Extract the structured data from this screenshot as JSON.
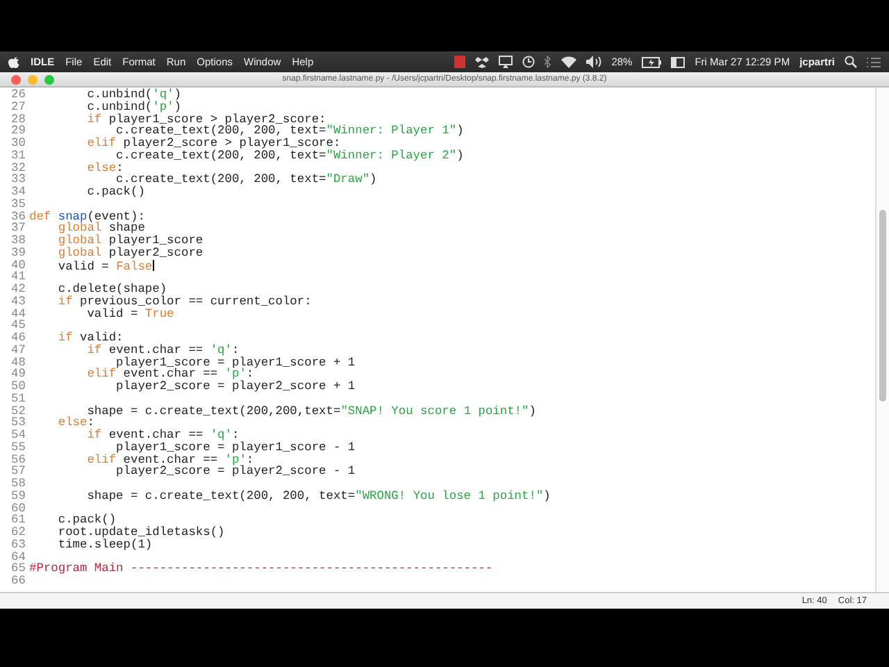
{
  "menu_bar": {
    "app_name": "IDLE",
    "menus": [
      "File",
      "Edit",
      "Format",
      "Run",
      "Options",
      "Window",
      "Help"
    ],
    "battery": "28%",
    "clock": "Fri Mar 27  12:29 PM",
    "user": "jcpartri"
  },
  "window": {
    "title": "snap.firstname.lastname.py - /Users/jcpartri/Desktop/snap.firstname.lastname.py (3.8.2)"
  },
  "editor": {
    "lines": [
      {
        "number": "26",
        "segments": [
          {
            "kind": "plain",
            "text": "        c.unbind("
          },
          {
            "kind": "string",
            "text": "'q'"
          },
          {
            "kind": "plain",
            "text": ")"
          }
        ]
      },
      {
        "number": "27",
        "segments": [
          {
            "kind": "plain",
            "text": "        c.unbind("
          },
          {
            "kind": "string",
            "text": "'p'"
          },
          {
            "kind": "plain",
            "text": ")"
          }
        ]
      },
      {
        "number": "28",
        "segments": [
          {
            "kind": "keyword",
            "text": "        if"
          },
          {
            "kind": "plain",
            "text": " player1_score > player2_score:"
          }
        ]
      },
      {
        "number": "29",
        "segments": [
          {
            "kind": "plain",
            "text": "            c.create_text(200, 200, text="
          },
          {
            "kind": "string",
            "text": "\"Winner: Player 1\""
          },
          {
            "kind": "plain",
            "text": ")"
          }
        ]
      },
      {
        "number": "30",
        "segments": [
          {
            "kind": "keyword",
            "text": "        elif"
          },
          {
            "kind": "plain",
            "text": " player2_score > player1_score:"
          }
        ]
      },
      {
        "number": "31",
        "segments": [
          {
            "kind": "plain",
            "text": "            c.create_text(200, 200, text="
          },
          {
            "kind": "string",
            "text": "\"Winner: Player 2\""
          },
          {
            "kind": "plain",
            "text": ")"
          }
        ]
      },
      {
        "number": "32",
        "segments": [
          {
            "kind": "keyword",
            "text": "        else"
          },
          {
            "kind": "plain",
            "text": ":"
          }
        ]
      },
      {
        "number": "33",
        "segments": [
          {
            "kind": "plain",
            "text": "            c.create_text(200, 200, text="
          },
          {
            "kind": "string",
            "text": "\"Draw\""
          },
          {
            "kind": "plain",
            "text": ")"
          }
        ]
      },
      {
        "number": "34",
        "segments": [
          {
            "kind": "plain",
            "text": "        c.pack()"
          }
        ]
      },
      {
        "number": "35"
      },
      {
        "number": "36",
        "segments": [
          {
            "kind": "keyword",
            "text": "def"
          },
          {
            "kind": "definition",
            "text": " snap"
          },
          {
            "kind": "plain",
            "text": "(event):"
          }
        ]
      },
      {
        "number": "37",
        "segments": [
          {
            "kind": "keyword",
            "text": "    global"
          },
          {
            "kind": "plain",
            "text": " shape"
          }
        ]
      },
      {
        "number": "38",
        "segments": [
          {
            "kind": "keyword",
            "text": "    global"
          },
          {
            "kind": "plain",
            "text": " player1_score"
          }
        ]
      },
      {
        "number": "39",
        "segments": [
          {
            "kind": "keyword",
            "text": "    global"
          },
          {
            "kind": "plain",
            "text": " player2_score"
          }
        ]
      },
      {
        "number": "40",
        "segments": [
          {
            "kind": "plain",
            "text": "    valid = "
          },
          {
            "kind": "keyword",
            "text": "False"
          },
          {
            "kind": "cursor"
          }
        ]
      },
      {
        "number": "41"
      },
      {
        "number": "42",
        "segments": [
          {
            "kind": "plain",
            "text": "    c.delete(shape)"
          }
        ]
      },
      {
        "number": "43",
        "segments": [
          {
            "kind": "keyword",
            "text": "    if"
          },
          {
            "kind": "plain",
            "text": " previous_color == current_color:"
          }
        ]
      },
      {
        "number": "44",
        "segments": [
          {
            "kind": "plain",
            "text": "        valid = "
          },
          {
            "kind": "keyword",
            "text": "True"
          }
        ]
      },
      {
        "number": "45"
      },
      {
        "number": "46",
        "segments": [
          {
            "kind": "keyword",
            "text": "    if"
          },
          {
            "kind": "plain",
            "text": " valid:"
          }
        ]
      },
      {
        "number": "47",
        "segments": [
          {
            "kind": "keyword",
            "text": "        if"
          },
          {
            "kind": "plain",
            "text": " event.char == "
          },
          {
            "kind": "string",
            "text": "'q'"
          },
          {
            "kind": "plain",
            "text": ":"
          }
        ]
      },
      {
        "number": "48",
        "segments": [
          {
            "kind": "plain",
            "text": "            player1_score = player1_score + 1"
          }
        ]
      },
      {
        "number": "49",
        "segments": [
          {
            "kind": "keyword",
            "text": "        elif"
          },
          {
            "kind": "plain",
            "text": " event.char == "
          },
          {
            "kind": "string",
            "text": "'p'"
          },
          {
            "kind": "plain",
            "text": ":"
          }
        ]
      },
      {
        "number": "50",
        "segments": [
          {
            "kind": "plain",
            "text": "            player2_score = player2_score + 1"
          }
        ]
      },
      {
        "number": "51"
      },
      {
        "number": "52",
        "segments": [
          {
            "kind": "plain",
            "text": "        shape = c.create_text(200,200,text="
          },
          {
            "kind": "string",
            "text": "\"SNAP! You score 1 point!\""
          },
          {
            "kind": "plain",
            "text": ")"
          }
        ]
      },
      {
        "number": "53",
        "segments": [
          {
            "kind": "keyword",
            "text": "    else"
          },
          {
            "kind": "plain",
            "text": ":"
          }
        ]
      },
      {
        "number": "54",
        "segments": [
          {
            "kind": "keyword",
            "text": "        if"
          },
          {
            "kind": "plain",
            "text": " event.char == "
          },
          {
            "kind": "string",
            "text": "'q'"
          },
          {
            "kind": "plain",
            "text": ":"
          }
        ]
      },
      {
        "number": "55",
        "segments": [
          {
            "kind": "plain",
            "text": "            player1_score = player1_score - 1"
          }
        ]
      },
      {
        "number": "56",
        "segments": [
          {
            "kind": "keyword",
            "text": "        elif"
          },
          {
            "kind": "plain",
            "text": " event.char == "
          },
          {
            "kind": "string",
            "text": "'p'"
          },
          {
            "kind": "plain",
            "text": ":"
          }
        ]
      },
      {
        "number": "57",
        "segments": [
          {
            "kind": "plain",
            "text": "            player2_score = player2_score - 1"
          }
        ]
      },
      {
        "number": "58"
      },
      {
        "number": "59",
        "segments": [
          {
            "kind": "plain",
            "text": "        shape = c.create_text(200, 200, text="
          },
          {
            "kind": "string",
            "text": "\"WRONG! You lose 1 point!\""
          },
          {
            "kind": "plain",
            "text": ")"
          }
        ]
      },
      {
        "number": "60"
      },
      {
        "number": "61",
        "segments": [
          {
            "kind": "plain",
            "text": "    c.pack()"
          }
        ]
      },
      {
        "number": "62",
        "segments": [
          {
            "kind": "plain",
            "text": "    root.update_idletasks()"
          }
        ]
      },
      {
        "number": "63",
        "segments": [
          {
            "kind": "plain",
            "text": "    time.sleep(1)"
          }
        ]
      },
      {
        "number": "64"
      },
      {
        "number": "65",
        "segments": [
          {
            "kind": "comment",
            "text": "#Program Main --------------------------------------------------"
          }
        ]
      },
      {
        "number": "66"
      }
    ]
  },
  "status_bar": {
    "line": "Ln: 40",
    "column": "Col: 17"
  }
}
